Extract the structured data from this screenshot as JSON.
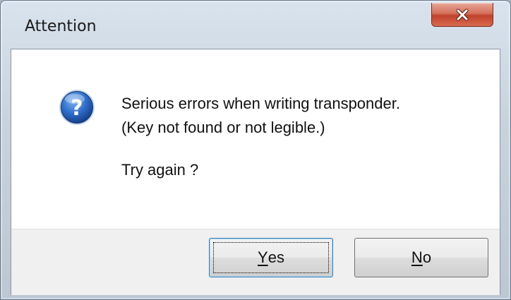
{
  "window": {
    "title": "Attention"
  },
  "dialog": {
    "icon": "question-icon",
    "message_lines": [
      "Serious errors when writing transponder.",
      "(Key not found or not legible.)"
    ],
    "prompt": "Try again ?"
  },
  "buttons": {
    "yes": {
      "mnemonic": "Y",
      "rest": "es"
    },
    "no": {
      "mnemonic": "N",
      "rest": "o"
    }
  },
  "colors": {
    "close_button": "#c0412a",
    "question_icon": "#1f5fb4",
    "default_button_border": "#3c7fb1"
  }
}
